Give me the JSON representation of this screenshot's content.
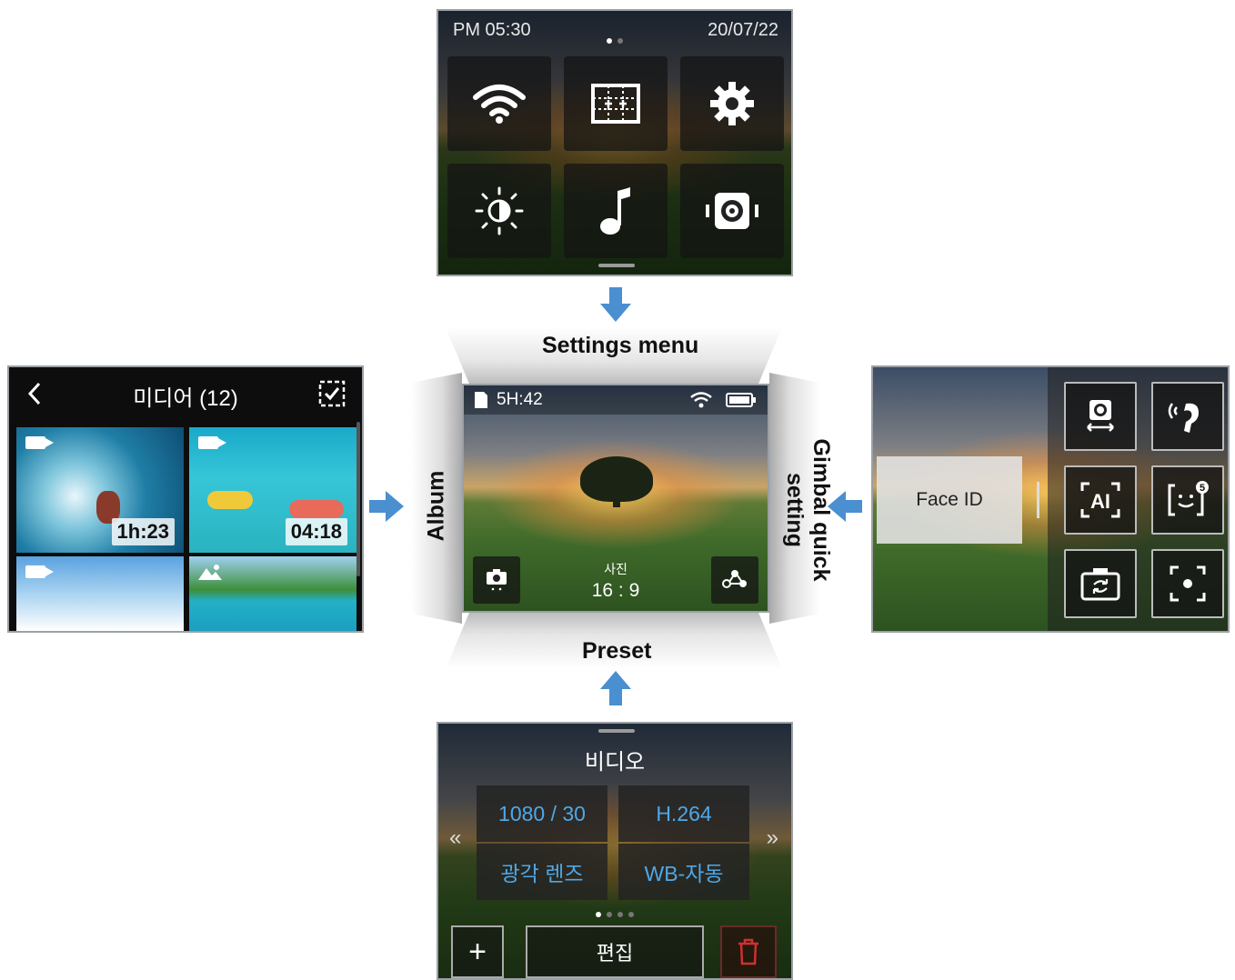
{
  "colors": {
    "arrow": "#4a8fd0",
    "accent_blue": "#4ea8e8",
    "delete_red": "#d03030"
  },
  "settings_screen": {
    "time": "PM 05:30",
    "date": "20/07/22",
    "tiles": [
      "wifi-icon",
      "grid-icon",
      "gear-icon",
      "brightness-icon",
      "music-note-icon",
      "camera-settings-icon"
    ]
  },
  "labels": {
    "settings_menu": "Settings menu",
    "album": "Album",
    "gimbal": "Gimbal quick setting",
    "preset": "Preset"
  },
  "main_screen": {
    "remaining": "5H:42",
    "mode_label": "사진",
    "ratio": "16 : 9"
  },
  "album_screen": {
    "title": "미디어 (12)",
    "thumbs": [
      {
        "type": "video",
        "duration": "1h:23"
      },
      {
        "type": "video",
        "duration": "04:18"
      },
      {
        "type": "video",
        "duration": ""
      },
      {
        "type": "photo",
        "duration": ""
      }
    ]
  },
  "gimbal_screen": {
    "face_id": "Face ID",
    "tiles": [
      "face-track-icon",
      "voice-control-icon",
      "ai-icon",
      "smile-count-icon",
      "camera-flip-icon",
      "center-focus-icon"
    ],
    "smile_badge": "5"
  },
  "preset_screen": {
    "title": "비디오",
    "cells": [
      "1080 / 30",
      "H.264",
      "광각 렌즈",
      "WB-자동"
    ],
    "prev": "«",
    "next": "»",
    "edit": "편집",
    "add": "+"
  }
}
